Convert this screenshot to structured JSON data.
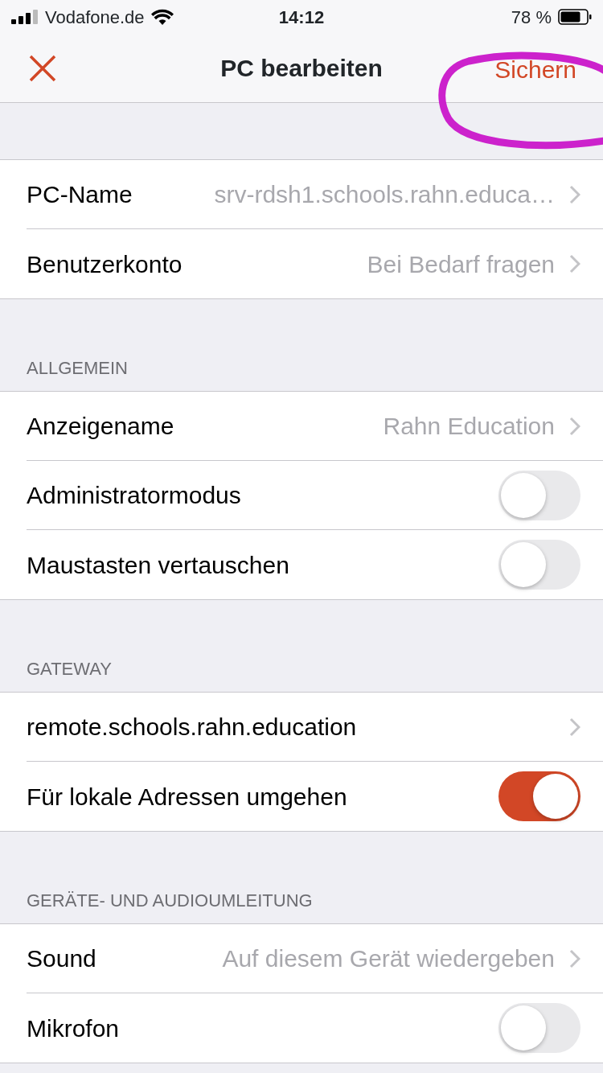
{
  "status_bar": {
    "carrier": "Vodafone.de",
    "time": "14:12",
    "battery": "78 %"
  },
  "nav": {
    "title": "PC bearbeiten",
    "save_button": {
      "label": "Sichern",
      "circled": true
    }
  },
  "sections": [
    {
      "rows": [
        {
          "kind": "link",
          "label": "PC-Name",
          "value": "srv-rdsh1.schools.rahn.educa…"
        },
        {
          "kind": "link",
          "label": "Benutzerkonto",
          "value": "Bei Bedarf fragen"
        }
      ]
    },
    {
      "header": "ALLGEMEIN",
      "rows": [
        {
          "kind": "link",
          "label": "Anzeigename",
          "value": "Rahn Education"
        },
        {
          "kind": "toggle",
          "label": "Administratormodus",
          "on": false
        },
        {
          "kind": "toggle",
          "label": "Maustasten vertauschen",
          "on": false
        }
      ]
    },
    {
      "header": "GATEWAY",
      "rows": [
        {
          "kind": "link",
          "label": "remote.schools.rahn.education"
        },
        {
          "kind": "toggle",
          "label": "Für lokale Adressen umgehen",
          "on": true
        }
      ]
    },
    {
      "header": "GERÄTE- UND AUDIOUMLEITUNG",
      "rows": [
        {
          "kind": "link",
          "label": "Sound",
          "value": "Auf diesem Gerät wiedergeben"
        },
        {
          "kind": "toggle",
          "label": "Mikrofon",
          "on": false
        }
      ]
    }
  ]
}
